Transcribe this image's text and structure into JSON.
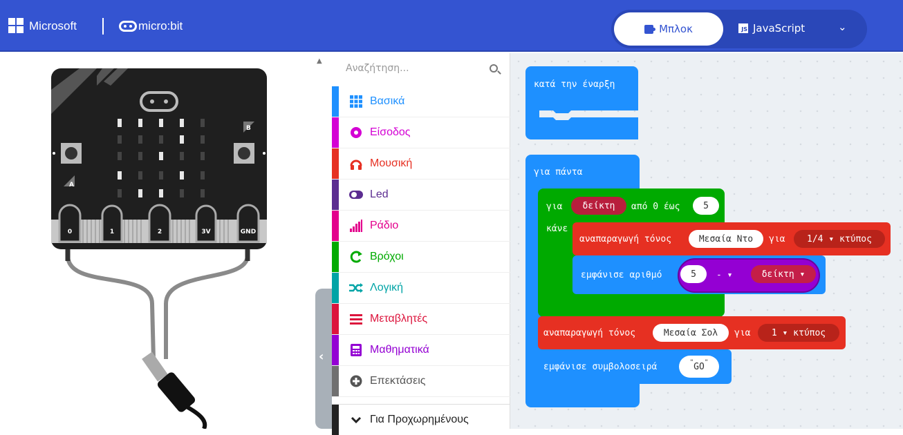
{
  "header": {
    "brand": "Microsoft",
    "product": "micro:bit",
    "blocks_label": "Μπλοκ",
    "js_label": "JavaScript",
    "js_badge": "JS"
  },
  "simulator": {
    "pins": [
      "0",
      "1",
      "2",
      "3V",
      "GND"
    ],
    "button_a": "A",
    "button_b": "B"
  },
  "toolbox": {
    "search_placeholder": "Αναζήτηση...",
    "categories": [
      {
        "label": "Βασικά",
        "color": "#1e90ff",
        "icon": "grid-icon"
      },
      {
        "label": "Είσοδος",
        "color": "#d400d4",
        "icon": "circle-icon"
      },
      {
        "label": "Μουσική",
        "color": "#e63022",
        "icon": "headphones-icon"
      },
      {
        "label": "Led",
        "color": "#5c2d91",
        "icon": "toggle-icon"
      },
      {
        "label": "Ράδιο",
        "color": "#e3008c",
        "icon": "signal-icon"
      },
      {
        "label": "Βρόχοι",
        "color": "#00aa00",
        "icon": "loop-icon"
      },
      {
        "label": "Λογική",
        "color": "#00a4a6",
        "icon": "shuffle-icon"
      },
      {
        "label": "Μεταβλητές",
        "color": "#dc143c",
        "icon": "list-icon"
      },
      {
        "label": "Μαθηματικά",
        "color": "#9400d3",
        "icon": "calculator-icon"
      },
      {
        "label": "Επεκτάσεις",
        "color": "#707070",
        "icon": "plus-circle-icon"
      },
      {
        "label": "Για Προχωρημένους",
        "color": "#222222",
        "icon": "chevron-down-icon"
      }
    ]
  },
  "workspace": {
    "on_start": "κατά την έναρξη",
    "forever": "για πάντα",
    "for_label": "για",
    "for_var": "δείκτη",
    "from_label": "από 0 έως",
    "for_to": "5",
    "do_label": "κάνε",
    "play_tone": "αναπαραγωγή τόνος",
    "tone1_note": "Μεσαία Ντο",
    "for_word": "για",
    "tone1_beat": "1/4 ▾ κτύπος",
    "show_number": "εμφάνισε αριθμό",
    "num_a": "5",
    "op": "- ▾",
    "num_b": "δείκτη ▾",
    "tone2_note": "Μεσαία Σολ",
    "tone2_beat": "1 ▾ κτύπος",
    "show_string": "εμφάνισε συμβολοσειρά",
    "string_val": "GO",
    "quote_open": "\"",
    "quote_close": "\""
  },
  "colors": {
    "header": "#3454d1",
    "basic": "#1e90ff",
    "loops": "#00aa00",
    "music": "#e63022",
    "variables": "#dc143c",
    "math": "#9400d3"
  }
}
